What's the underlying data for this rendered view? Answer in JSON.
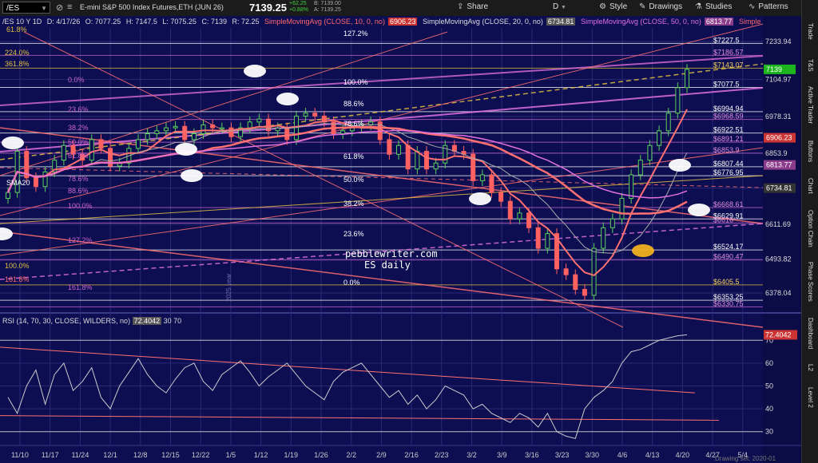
{
  "toolbar": {
    "symbol": "/ES",
    "description": "E-mini S&P 500 Index Futures,ETH (JUN 26)",
    "last_price": "7139.25",
    "change": "+62.25",
    "change_pct": "+0.88%",
    "bid": "B: 7139.00",
    "ask": "A: 7139.25",
    "share_label": "Share",
    "period_label": "D",
    "style_label": "Style",
    "drawings_label": "Drawings",
    "studies_label": "Studies",
    "patterns_label": "Patterns"
  },
  "legend": {
    "interval": "/ES 10 Y 1D",
    "date": "D: 4/17/26",
    "open": "O: 7077.25",
    "high": "H: 7147.5",
    "low": "L: 7075.25",
    "close": "C: 7139",
    "range": "R: 72.25",
    "sma10_label": "SimpleMovingAvg (CLOSE, 10, 0, no)",
    "sma10_value": "6906.23",
    "sma20_label": "SimpleMovingAvg (CLOSE, 20, 0, no)",
    "sma20_value": "6734.81",
    "sma50_label": "SimpleMovingAvg (CLOSE, 50, 0, no)",
    "sma50_value": "6813.77",
    "sma_more": "Simple"
  },
  "price_axis": [
    "7233.94",
    "7104.97",
    "6978.31",
    "6853.9",
    "6734.81",
    "6611.69",
    "6493.82",
    "6378.04"
  ],
  "price_badges": [
    {
      "label": "7139",
      "color": "#1db51d"
    },
    {
      "label": "6906.23",
      "color": "#cc3333"
    },
    {
      "label": "6813.77",
      "color": "#8b3c8b"
    },
    {
      "label": "6734.81",
      "color": "#333333"
    }
  ],
  "fib_left": [
    "61.8%",
    "224.0%",
    "361.8%",
    "0.0%",
    "23.6%",
    "38.2%",
    "50.0%",
    "61.8%",
    "78.6%",
    "88.6%",
    "100.0%",
    "127.2%",
    "100.0%",
    "161.8%",
    "161.8%"
  ],
  "fib_mid": [
    "127.2%",
    "100.0%",
    "88.6%",
    "78.6%",
    "61.8%",
    "50.0%",
    "38.2%",
    "23.6%",
    "0.0%"
  ],
  "fib_right": [
    "$7227.5",
    "$7186.57",
    "$7143.07",
    "$7077.5",
    "$6994.94",
    "$6968.59",
    "$6922.51",
    "$6891.21",
    "$6853.9",
    "$6807.44",
    "$6776.95",
    "$6668.61",
    "$6629.91",
    "$6616",
    "$6524.17",
    "$6490.47",
    "$6405.5",
    "$6353.25",
    "$6330.75"
  ],
  "sma20_tag": "SMA20",
  "watermark": "pebblewriter.com\nES daily",
  "watermark_1": "pebblewriter.com",
  "watermark_2": "ES daily",
  "year_tag": "2025 year",
  "rsi": {
    "label": "RSI (14, 70, 30, CLOSE, WILDERS, no)",
    "value": "72.4042",
    "ob": "30",
    "os": "70",
    "axis": [
      "70",
      "60",
      "50",
      "40",
      "30"
    ]
  },
  "dates": [
    "11/10",
    "11/17",
    "11/24",
    "12/1",
    "12/8",
    "12/15",
    "12/22",
    "1/5",
    "1/12",
    "1/19",
    "1/26",
    "2/2",
    "2/9",
    "2/16",
    "2/23",
    "3/2",
    "3/9",
    "3/16",
    "3/23",
    "3/30",
    "4/6",
    "4/13",
    "4/20",
    "4/27",
    "5/4"
  ],
  "status": "Drawing set: 2020-01",
  "sidebar": [
    "Trade",
    "T&S",
    "Active Trader",
    "Buttons",
    "Chart",
    "Option Chain",
    "Phase Scores",
    "Dashboard",
    "L2",
    "Level 2"
  ],
  "chart_data": {
    "type": "candlestick",
    "title": "",
    "ylim": [
      6330,
      7260
    ],
    "candles_close": [
      6720,
      6860,
      6770,
      6740,
      6790,
      6830,
      6880,
      6850,
      6830,
      6900,
      6870,
      6810,
      6820,
      6870,
      6900,
      6920,
      6930,
      6940,
      6945,
      6900,
      6920,
      6950,
      6940,
      6940,
      6910,
      6940,
      6960,
      6970,
      6930,
      6940,
      6900,
      6980,
      6990,
      6980,
      6960,
      6920,
      6930,
      6940,
      6950,
      6960,
      6900,
      6850,
      6880,
      6800,
      6860,
      6800,
      6820,
      6880,
      6860,
      6850,
      6760,
      6780,
      6720,
      6690,
      6630,
      6650,
      6600,
      6530,
      6580,
      6460,
      6440,
      6390,
      6370,
      6530,
      6600,
      6630,
      6700,
      6780,
      6830,
      6880,
      6930,
      6990,
      7077,
      7139
    ]
  }
}
